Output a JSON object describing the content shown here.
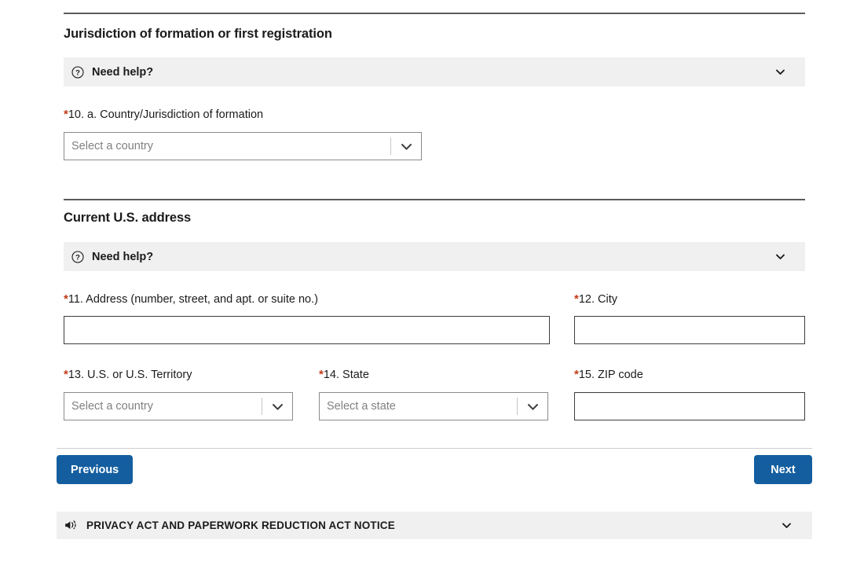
{
  "sections": [
    {
      "title": "Jurisdiction of formation or first registration",
      "help": {
        "label": "Need help?",
        "icon": "question-circle-icon",
        "chevron": "chevron-down-icon"
      }
    },
    {
      "title": "Current U.S. address",
      "help": {
        "label": "Need help?",
        "icon": "question-circle-icon",
        "chevron": "chevron-down-icon"
      }
    }
  ],
  "fields": {
    "country_of_formation": {
      "label": "10. a. Country/Jurisdiction of formation",
      "required_marker": "*",
      "placeholder": "Select a country",
      "value": "",
      "type": "select"
    },
    "address": {
      "label": "11. Address (number, street, and apt. or suite no.)",
      "required_marker": "*",
      "placeholder": "",
      "value": "",
      "type": "text"
    },
    "city": {
      "label": "12. City",
      "required_marker": "*",
      "placeholder": "",
      "value": "",
      "type": "text"
    },
    "us_or_territory": {
      "label": "13. U.S. or U.S. Territory",
      "required_marker": "*",
      "placeholder": "Select a country",
      "value": "",
      "type": "select"
    },
    "state": {
      "label": "14. State",
      "required_marker": "*",
      "placeholder": "Select a state",
      "value": "",
      "type": "select"
    },
    "zip": {
      "label": "15. ZIP code",
      "required_marker": "*",
      "placeholder": "",
      "value": "",
      "type": "text"
    }
  },
  "buttons": {
    "previous": "Previous",
    "next": "Next"
  },
  "privacy": {
    "label": "PRIVACY ACT AND PAPERWORK REDUCTION ACT NOTICE",
    "icon": "bullhorn-icon",
    "chevron": "chevron-down-icon"
  },
  "colors": {
    "button_blue": "#145ea0",
    "required_red": "#c33a17",
    "accordion_gray": "#f0f0f0",
    "rule_dark": "#5b5b5b"
  }
}
